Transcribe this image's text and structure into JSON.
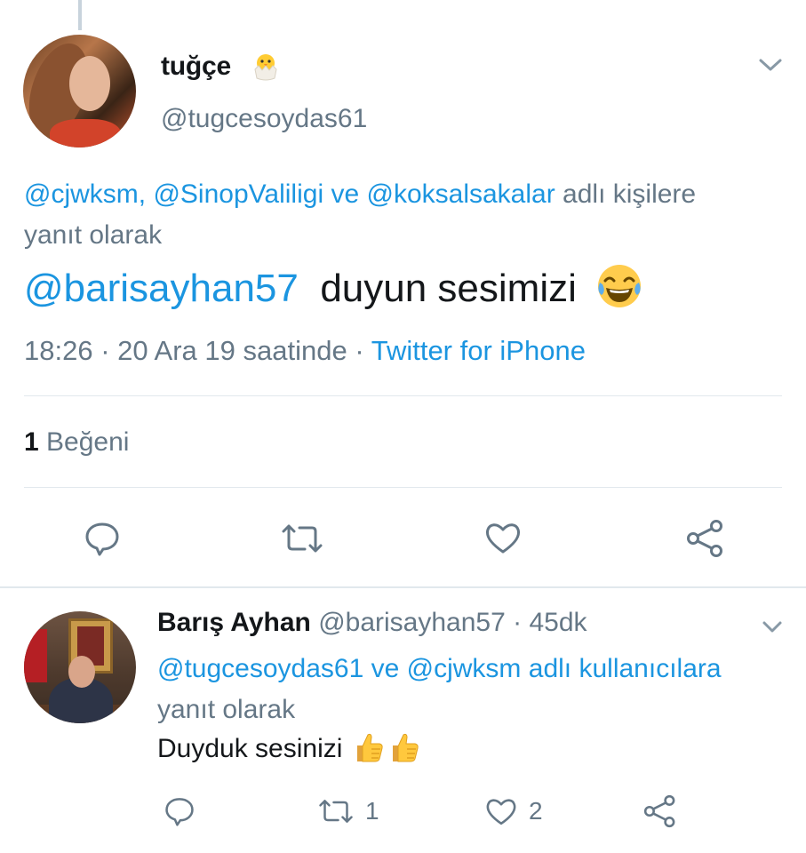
{
  "colors": {
    "accent": "#1b95e0",
    "muted": "#657786",
    "text": "#14171a",
    "divider": "#e1e8ed"
  },
  "main_tweet": {
    "name": "tuğçe",
    "name_emoji_icon": "hatching-chick-icon",
    "handle": "@tugcesoydas61",
    "reply_to": {
      "mention_1": "@cjwksm,",
      "mention_2": "@SinopValiligi",
      "joiner": "ve",
      "mention_3": "@koksalsakalar",
      "suffix": "adlı kişilere yanıt olarak"
    },
    "text": {
      "mention": "@barisayhan57",
      "body": "duyun sesimizi",
      "emoji_icon": "face-with-tears-of-joy-icon"
    },
    "meta": {
      "time": "18:26",
      "dot_1": "·",
      "date": "20 Ara 19 saatinde",
      "dot_2": "·",
      "source": "Twitter for iPhone"
    },
    "likes": {
      "count": "1",
      "label": "Beğeni"
    },
    "actions": {
      "reply_icon": "reply-icon",
      "retweet_icon": "retweet-icon",
      "like_icon": "heart-icon",
      "share_icon": "share-icon"
    }
  },
  "reply_tweet": {
    "name": "Barış Ayhan",
    "handle": "@barisayhan57",
    "dot": "·",
    "time_ago": "45dk",
    "reply_to": {
      "mention_1": "@tugcesoydas61",
      "joiner": "ve",
      "mention_2": "@cjwksm",
      "link_word_1": "adlı",
      "link_word_2": "kullanıcılara",
      "suffix": "yanıt olarak"
    },
    "text": {
      "body": "Duyduk sesinizi",
      "emoji_icon": "thumbs-up-icon"
    },
    "actions": {
      "reply_count": "",
      "retweet_count": "1",
      "like_count": "2"
    }
  }
}
